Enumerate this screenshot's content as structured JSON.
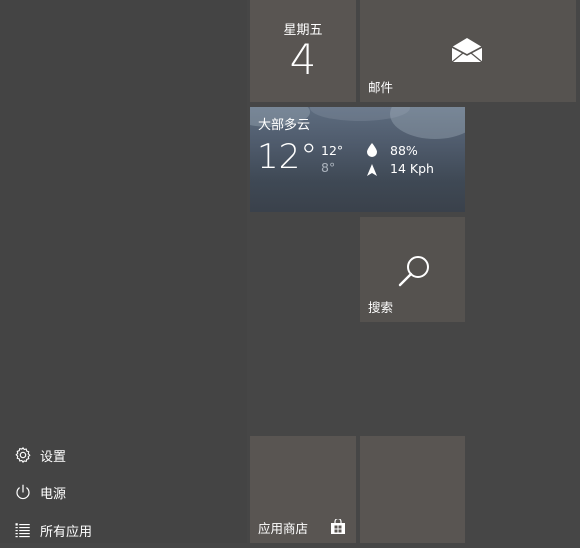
{
  "colors": {
    "background": "#464646",
    "menu_background": "#444444",
    "tile_background": "#595552",
    "weather_tile_top": "#5e6d80",
    "text": "#ffffff",
    "muted_text": "#aab2bc"
  },
  "left_menu": {
    "items": [
      {
        "label": "设置",
        "icon": "gear-icon"
      },
      {
        "label": "电源",
        "icon": "power-icon"
      },
      {
        "label": "所有应用",
        "icon": "list-icon"
      }
    ]
  },
  "tiles": {
    "calendar": {
      "day": "星期五",
      "date": "4"
    },
    "mail": {
      "label": "邮件",
      "icon": "envelope-icon"
    },
    "weather": {
      "location": "大部多云",
      "temperature": "12°",
      "high": "12°",
      "low": "8°",
      "humidity": "88%",
      "wind": "14 Kph",
      "humidity_icon": "droplet-icon",
      "wind_icon": "wind-direction-icon"
    },
    "search": {
      "label": "搜索",
      "icon": "search-icon"
    },
    "store": {
      "label": "应用商店",
      "icon": "store-bag-icon"
    }
  }
}
